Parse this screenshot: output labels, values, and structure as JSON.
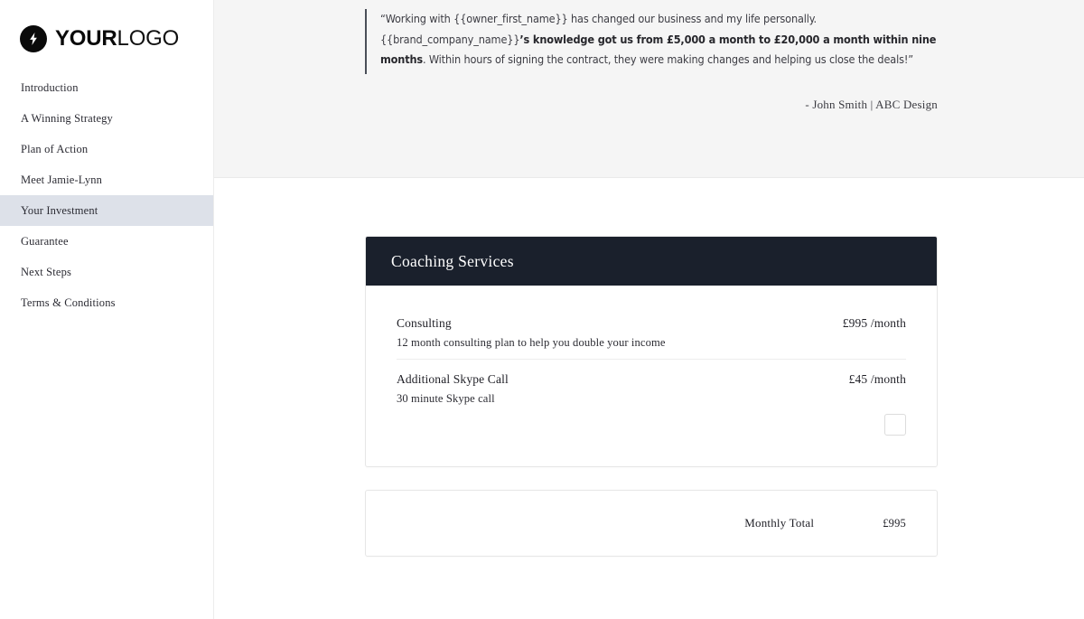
{
  "sidebar": {
    "logo": {
      "icon": "lightning-bolt-icon",
      "bold_text": "YOUR",
      "light_text": "LOGO"
    },
    "items": [
      {
        "label": "Introduction",
        "active": false
      },
      {
        "label": "A Winning Strategy",
        "active": false
      },
      {
        "label": "Plan of Action",
        "active": false
      },
      {
        "label": "Meet Jamie-Lynn",
        "active": false
      },
      {
        "label": "Your Investment",
        "active": true
      },
      {
        "label": "Guarantee",
        "active": false
      },
      {
        "label": "Next Steps",
        "active": false
      },
      {
        "label": "Terms & Conditions",
        "active": false
      }
    ],
    "active_item_color": "#dde1e9"
  },
  "testimonial": {
    "quote_part1": "“Working with {{owner_first_name}} has changed our business and my life personally. {{brand_company_name}}",
    "quote_bold1": "’s knowledge got us from £5,000 a month to £20,000 a month within nine months",
    "quote_part2": ". Within hours of signing the contract, they were making changes and helping us close the deals!”",
    "attribution": "- John Smith  |  ABC Design",
    "background": "#f5f5f5",
    "accent_border": "#4a4f58"
  },
  "investment": {
    "card": {
      "header_title": "Coaching Services",
      "header_background": "#1a202c",
      "items": [
        {
          "name": "Consulting",
          "price": "£995 /month",
          "description": "12 month consulting plan to help you double your income",
          "has_checkbox": false,
          "checked": false
        },
        {
          "name": "Additional Skype Call",
          "price": "£45 /month",
          "description": "30 minute Skype call",
          "has_checkbox": true,
          "checked": false
        }
      ]
    },
    "total": {
      "label": "Monthly Total",
      "value": "£995"
    }
  }
}
